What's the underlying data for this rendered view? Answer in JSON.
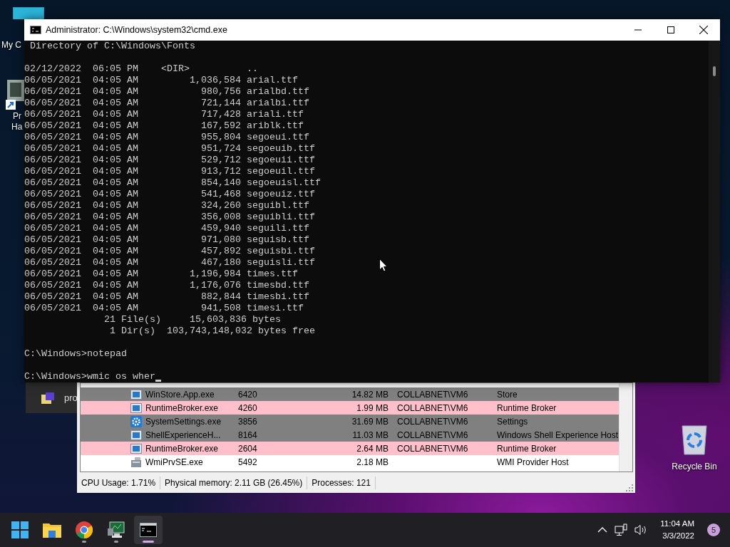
{
  "desktop_icons": [
    {
      "kind": "computer",
      "lines": [
        "My C"
      ]
    },
    {
      "kind": "shortcut",
      "lines": [
        "Pr",
        "Ha"
      ]
    },
    {
      "kind": "recycle_bin",
      "lines": [
        "Recycle Bin"
      ]
    }
  ],
  "background_window": {
    "title": "pro"
  },
  "process_window": {
    "rows": [
      {
        "kind": "app",
        "name": "WinStore.App.exe",
        "pid": "6420",
        "memory": "14.82 MB",
        "user": "COLLABNET\\VM6",
        "description": "Store",
        "color": "#808080"
      },
      {
        "kind": "app",
        "name": "RuntimeBroker.exe",
        "pid": "4260",
        "memory": "1.99 MB",
        "user": "COLLABNET\\VM6",
        "description": "Runtime Broker",
        "color": "#ffc0cb"
      },
      {
        "kind": "settings",
        "name": "SystemSettings.exe",
        "pid": "3856",
        "memory": "31.69 MB",
        "user": "COLLABNET\\VM6",
        "description": "Settings",
        "color": "#808080"
      },
      {
        "kind": "app",
        "name": "ShellExperienceH...",
        "pid": "8164",
        "memory": "11.03 MB",
        "user": "COLLABNET\\VM6",
        "description": "Windows Shell Experience Host",
        "color": "#808080"
      },
      {
        "kind": "app",
        "name": "RuntimeBroker.exe",
        "pid": "2604",
        "memory": "2.64 MB",
        "user": "COLLABNET\\VM6",
        "description": "Runtime Broker",
        "color": "#ffc0cb"
      },
      {
        "kind": "service",
        "name": "WmiPrvSE.exe",
        "pid": "5492",
        "memory": "2.18 MB",
        "user": "",
        "description": "WMI Provider Host",
        "color": "#ffffff"
      }
    ],
    "status_bar": [
      "CPU Usage: 1.71%",
      "Physical memory: 2.11 GB (26.45%)",
      "Processes: 121"
    ]
  },
  "console": {
    "title": "Administrator: C:\\Windows\\system32\\cmd.exe",
    "cursor": true,
    "blocks": [
      [
        " Directory of C:\\Windows\\Fonts"
      ],
      [
        "02/12/2022  06:05 PM    <DIR>          ..",
        "06/05/2021  04:05 AM         1,036,584 arial.ttf",
        "06/05/2021  04:05 AM           980,756 arialbd.ttf",
        "06/05/2021  04:05 AM           721,144 arialbi.ttf",
        "06/05/2021  04:05 AM           717,428 ariali.ttf",
        "06/05/2021  04:05 AM           167,592 ariblk.ttf",
        "06/05/2021  04:05 AM           955,804 segoeui.ttf",
        "06/05/2021  04:05 AM           951,724 segoeuib.ttf",
        "06/05/2021  04:05 AM           529,712 segoeuii.ttf",
        "06/05/2021  04:05 AM           913,712 segoeuil.ttf",
        "06/05/2021  04:05 AM           854,140 segoeuisl.ttf",
        "06/05/2021  04:05 AM           541,468 segoeuiz.ttf",
        "06/05/2021  04:05 AM           324,260 seguibl.ttf",
        "06/05/2021  04:05 AM           356,008 seguibli.ttf",
        "06/05/2021  04:05 AM           459,940 seguili.ttf",
        "06/05/2021  04:05 AM           971,080 seguisb.ttf",
        "06/05/2021  04:05 AM           457,892 seguisbi.ttf",
        "06/05/2021  04:05 AM           467,180 seguisli.ttf",
        "06/05/2021  04:05 AM         1,196,984 times.ttf",
        "06/05/2021  04:05 AM         1,176,076 timesbd.ttf",
        "06/05/2021  04:05 AM           882,844 timesbi.ttf",
        "06/05/2021  04:05 AM           941,508 timesi.ttf",
        "              21 File(s)     15,603,836 bytes",
        "               1 Dir(s)  103,743,148,032 bytes free"
      ],
      [
        "C:\\Windows>notepad"
      ],
      [
        "C:\\Windows>wmic os wher"
      ]
    ]
  },
  "taskbar": {
    "apps": [
      {
        "kind": "start",
        "running": false,
        "selected": false
      },
      {
        "kind": "folder",
        "running": false,
        "selected": false
      },
      {
        "kind": "browser",
        "running": true,
        "selected": false
      },
      {
        "kind": "monitor",
        "running": true,
        "selected": false
      },
      {
        "kind": "terminal",
        "running": true,
        "selected": true
      }
    ],
    "tray": {
      "time": "11:04 AM",
      "date": "3/3/2022",
      "notifications": "5"
    }
  }
}
